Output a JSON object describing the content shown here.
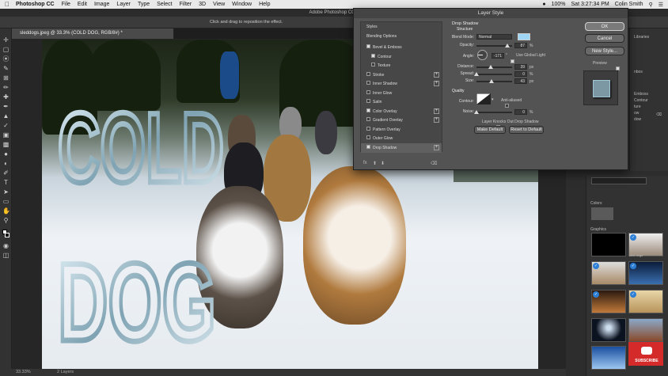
{
  "menubar": {
    "app": "Photoshop CC",
    "items": [
      "File",
      "Edit",
      "Image",
      "Layer",
      "Type",
      "Select",
      "Filter",
      "3D",
      "View",
      "Window",
      "Help"
    ],
    "battery": "100%",
    "clock": "Sat 3:27:34 PM",
    "user": "Colin Smith"
  },
  "window": {
    "title": "Adobe Photoshop CC 2",
    "hint": "Click and drag to reposition the effect.",
    "doc_tab": "sleddogs.jpeg @ 33.3% (COLD DOG, RGB/8#) *"
  },
  "canvas": {
    "text_line1": "COLD",
    "text_line2": "DOG"
  },
  "status": {
    "zoom": "33.33%",
    "info": "2 Layers"
  },
  "dialog": {
    "title": "Layer Style",
    "styles_header": "Styles",
    "blending_options": "Blending Options",
    "effects": [
      {
        "label": "Bevel & Emboss",
        "checked": true,
        "plus": false
      },
      {
        "label": "Contour",
        "checked": true,
        "plus": false
      },
      {
        "label": "Texture",
        "checked": false,
        "plus": false
      },
      {
        "label": "Stroke",
        "checked": false,
        "plus": true
      },
      {
        "label": "Inner Shadow",
        "checked": false,
        "plus": true
      },
      {
        "label": "Inner Glow",
        "checked": false,
        "plus": false
      },
      {
        "label": "Satin",
        "checked": false,
        "plus": false
      },
      {
        "label": "Color Overlay",
        "checked": true,
        "plus": true
      },
      {
        "label": "Gradient Overlay",
        "checked": false,
        "plus": true
      },
      {
        "label": "Pattern Overlay",
        "checked": false,
        "plus": false
      },
      {
        "label": "Outer Glow",
        "checked": false,
        "plus": false
      },
      {
        "label": "Drop Shadow",
        "checked": true,
        "plus": true
      }
    ],
    "fx_label": "fx",
    "section_title": "Drop Shadow",
    "structure_title": "Structure",
    "blend_mode_label": "Blend Mode:",
    "blend_mode_value": "Normal",
    "shadow_color": "#9fd6f5",
    "opacity_label": "Opacity:",
    "opacity_value": "87",
    "angle_label": "Angle:",
    "angle_value": "-171",
    "use_global_light": "Use Global Light",
    "distance_label": "Distance:",
    "distance_value": "39",
    "spread_label": "Spread:",
    "spread_value": "0",
    "size_label": "Size:",
    "size_value": "43",
    "px": "px",
    "percent": "%",
    "quality_title": "Quality",
    "contour_label": "Contour:",
    "anti_aliased": "Anti-aliased",
    "noise_label": "Noise:",
    "noise_value": "0",
    "knock_out": "Layer Knocks Out Drop Shadow",
    "make_default": "Make Default",
    "reset_default": "Reset to Default",
    "ok": "OK",
    "cancel": "Cancel",
    "new_style": "New Style...",
    "preview": "Preview"
  },
  "panels": {
    "tab_label": "Libraries",
    "items": [
      "nbos",
      "Emboss",
      "Contour",
      "ture",
      "ow",
      "dow"
    ],
    "colors": "Colors",
    "graphics": "Graphics",
    "thumb_caption": "sled dogs",
    "subscribe": "SUBSCRIBE"
  }
}
